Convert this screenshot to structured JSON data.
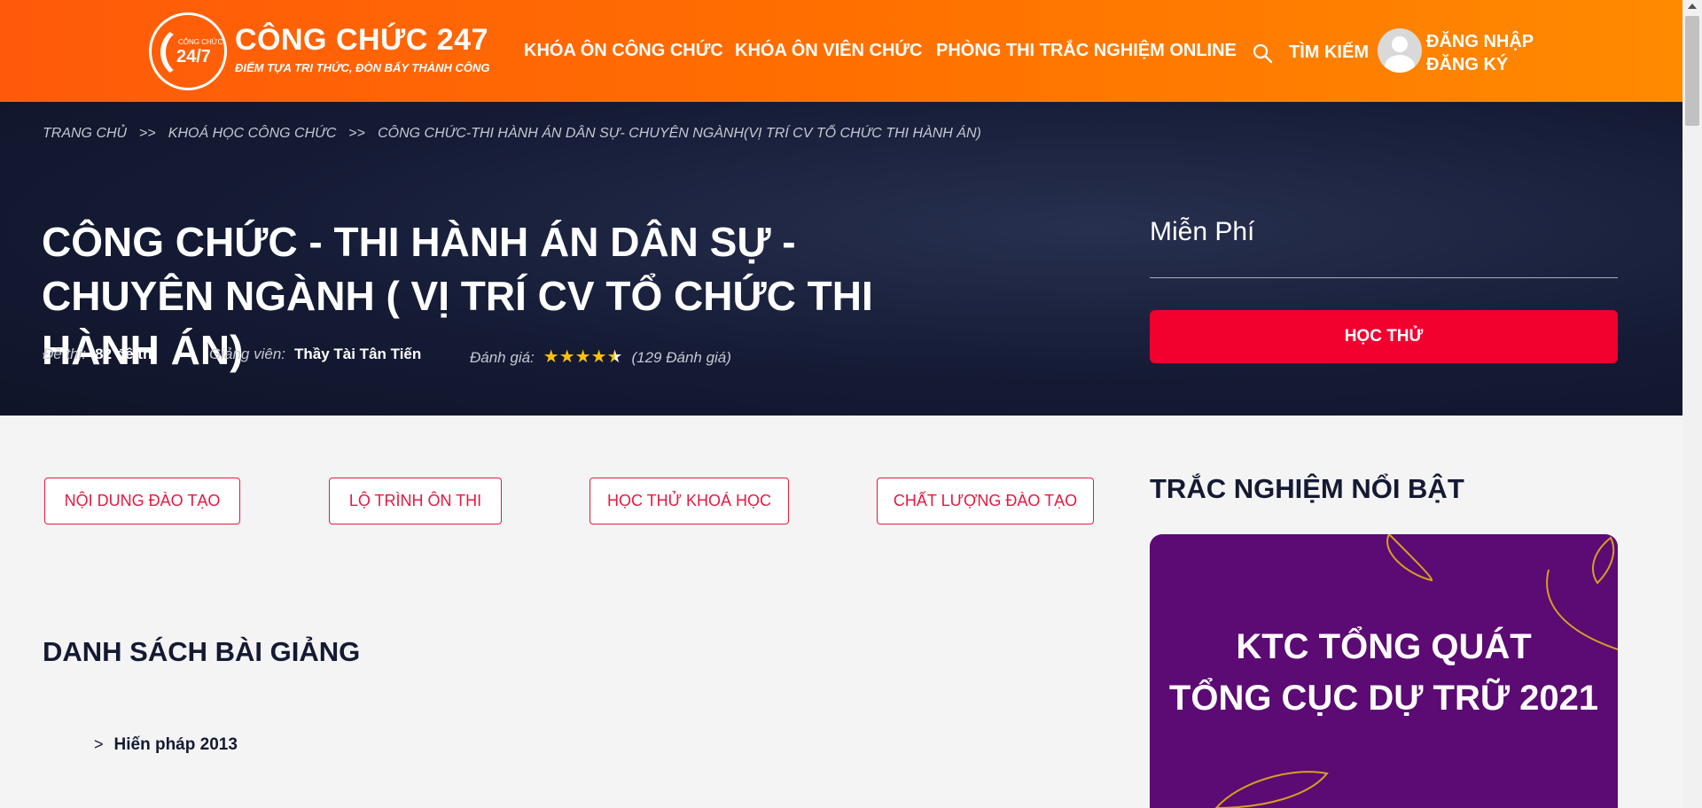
{
  "header": {
    "logo_small_text": "CÔNG CHỨC",
    "logo_big_text": "24/7",
    "brand_title": "CÔNG CHỨC 247",
    "brand_slogan": "ĐIỂM TỰA TRI THỨC, ĐÒN BẨY THÀNH CÔNG",
    "nav": [
      "KHÓA ÔN CÔNG CHỨC",
      "KHÓA ÔN VIÊN CHỨC",
      "PHÒNG THI TRẮC NGHIỆM ONLINE"
    ],
    "search_label": "TÌM KIẾM",
    "login_label": "ĐĂNG NHẬP",
    "register_label": "ĐĂNG KÝ"
  },
  "breadcrumb": {
    "items": [
      "TRANG CHỦ",
      "KHOÁ HỌC CÔNG CHỨC",
      "CÔNG CHỨC-THI HÀNH ÁN DÂN SỰ- CHUYÊN NGÀNH(VỊ TRÍ CV TỔ CHỨC THI HÀNH ÁN)"
    ],
    "separator": ">>"
  },
  "course": {
    "title": "CÔNG CHỨC - THI HÀNH ÁN DÂN SỰ - CHUYÊN NGÀNH ( VỊ TRÍ CV TỔ CHỨC THI HÀNH ÁN)",
    "exams_label": "Đề thi:",
    "exams_value": "82 đề thi",
    "teacher_label": "Giảng viên:",
    "teacher_value": "Thầy Tài Tân Tiến",
    "rating_label": "Đánh giá:",
    "rating_stars": 4.5,
    "rating_count": "(129 Đánh giá)",
    "price": "Miễn Phí",
    "try_button": "HỌC THỬ"
  },
  "tabs": [
    "NỘI DUNG ĐÀO TẠO",
    "LỘ TRÌNH ÔN THI",
    "HỌC THỬ KHOÁ HỌC",
    "CHẤT LƯỢNG ĐÀO TẠO"
  ],
  "lectures": {
    "title": "DANH SÁCH BÀI GIẢNG",
    "items": [
      "Hiến pháp 2013"
    ]
  },
  "sidebar": {
    "title": "TRẮC NGHIỆM NỔI BẬT",
    "promo_line1": "KTC TỔNG QUÁT",
    "promo_line2": "TỔNG CỤC DỰ TRỮ 2021"
  },
  "colors": {
    "header_orange": "#ff6f00",
    "hero_navy": "#151b35",
    "accent_red": "#f2002e",
    "promo_purple": "#5c0a74",
    "star_gold": "#ffc107"
  }
}
